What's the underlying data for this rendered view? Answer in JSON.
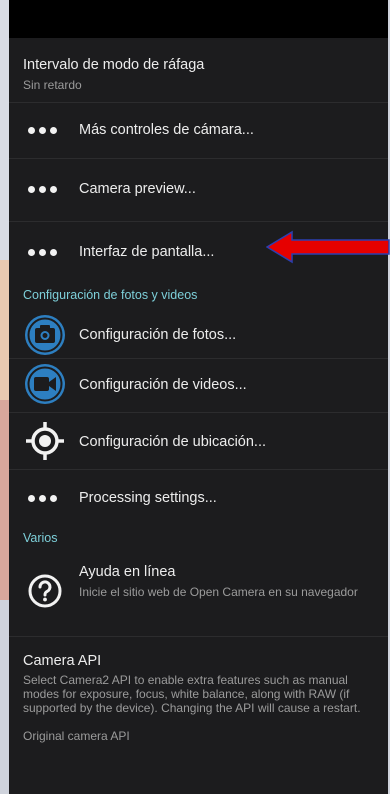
{
  "burst": {
    "title": "Intervalo de modo de ráfaga",
    "subtitle": "Sin retardo"
  },
  "items": [
    {
      "label": "Más controles de cámara..."
    },
    {
      "label": "Camera preview..."
    },
    {
      "label": "Interfaz de pantalla..."
    }
  ],
  "section_photos": {
    "title": "Configuración de fotos y videos"
  },
  "photo_items": [
    {
      "label": "Configuración de fotos...",
      "icon": "camera-icon"
    },
    {
      "label": "Configuración de videos...",
      "icon": "video-camera-icon"
    },
    {
      "label": "Configuración de ubicación...",
      "icon": "location-crosshair-icon"
    },
    {
      "label": "Processing settings...",
      "icon": "more-dots-icon"
    }
  ],
  "section_misc": {
    "title": "Varios"
  },
  "help": {
    "title": "Ayuda en línea",
    "subtitle": "Inicie el sitio web de Open Camera en su navegador",
    "icon": "help-icon"
  },
  "camera_api": {
    "title": "Camera API",
    "description": "Select Camera2 API to enable extra features such as manual modes for exposure, focus, white balance, along with RAW (if supported by the device). Changing the API will cause a restart.",
    "value": "Original camera API"
  },
  "colors": {
    "accent": "#2d7fc1",
    "section": "#7dcfd9",
    "arrow": "#e60000"
  }
}
